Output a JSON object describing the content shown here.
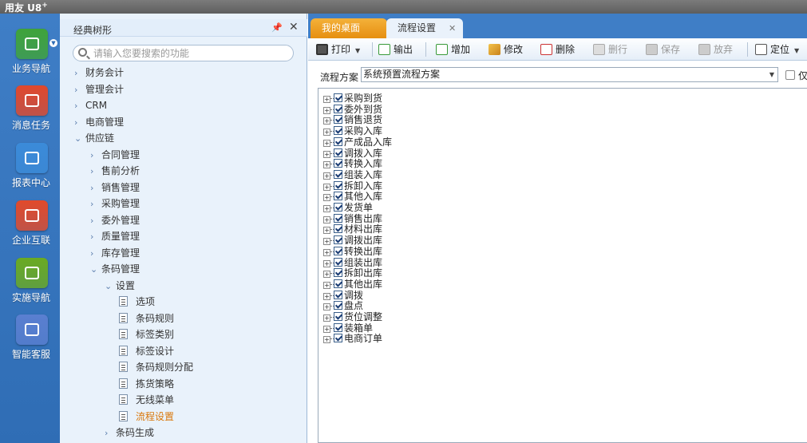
{
  "app": {
    "brand": "用友 U8",
    "brand_sup": "+"
  },
  "dock": [
    {
      "label": "业务导航",
      "icon": "business-nav-icon",
      "color": "#3fa33a"
    },
    {
      "label": "消息任务",
      "icon": "message-task-icon",
      "color": "#e0482c"
    },
    {
      "label": "报表中心",
      "icon": "report-center-icon",
      "color": "#3b8bd9"
    },
    {
      "label": "企业互联",
      "icon": "enterprise-link-icon",
      "color": "#e14a2b"
    },
    {
      "label": "实施导航",
      "icon": "implementation-nav-icon",
      "color": "#6aaa22"
    },
    {
      "label": "智能客服",
      "icon": "smart-service-icon",
      "color": "#5a7fd0"
    }
  ],
  "nav": {
    "title": "经典树形",
    "search_placeholder": "请输入您要搜索的功能",
    "tree": [
      {
        "label": "财务会计",
        "level": 0,
        "type": "collapsed"
      },
      {
        "label": "管理会计",
        "level": 0,
        "type": "collapsed"
      },
      {
        "label": "CRM",
        "level": 0,
        "type": "collapsed"
      },
      {
        "label": "电商管理",
        "level": 0,
        "type": "collapsed"
      },
      {
        "label": "供应链",
        "level": 0,
        "type": "expanded"
      },
      {
        "label": "合同管理",
        "level": 1,
        "type": "collapsed"
      },
      {
        "label": "售前分析",
        "level": 1,
        "type": "collapsed"
      },
      {
        "label": "销售管理",
        "level": 1,
        "type": "collapsed"
      },
      {
        "label": "采购管理",
        "level": 1,
        "type": "collapsed"
      },
      {
        "label": "委外管理",
        "level": 1,
        "type": "collapsed"
      },
      {
        "label": "质量管理",
        "level": 1,
        "type": "collapsed"
      },
      {
        "label": "库存管理",
        "level": 1,
        "type": "collapsed"
      },
      {
        "label": "条码管理",
        "level": 1,
        "type": "expanded"
      },
      {
        "label": "设置",
        "level": 2,
        "type": "expanded"
      },
      {
        "label": "选项",
        "level": 3,
        "type": "leaf"
      },
      {
        "label": "条码规则",
        "level": 3,
        "type": "leaf"
      },
      {
        "label": "标签类别",
        "level": 3,
        "type": "leaf"
      },
      {
        "label": "标签设计",
        "level": 3,
        "type": "leaf"
      },
      {
        "label": "条码规则分配",
        "level": 3,
        "type": "leaf"
      },
      {
        "label": "拣货策略",
        "level": 3,
        "type": "leaf"
      },
      {
        "label": "无线菜单",
        "level": 3,
        "type": "leaf"
      },
      {
        "label": "流程设置",
        "level": 3,
        "type": "leaf",
        "active": true
      },
      {
        "label": "条码生成",
        "level": 2,
        "type": "collapsed"
      }
    ]
  },
  "tabs": [
    {
      "label": "我的桌面"
    },
    {
      "label": "流程设置"
    }
  ],
  "toolbar": {
    "print": "打印",
    "export": "输出",
    "add": "增加",
    "edit": "修改",
    "delete": "删除",
    "delete_row": "删行",
    "save": "保存",
    "abandon": "放弃",
    "locate": "定位"
  },
  "scheme": {
    "label": "流程方案",
    "value": "系统预置流程方案",
    "only_label": "仅"
  },
  "flows": [
    {
      "label": "采购到货",
      "checked": true
    },
    {
      "label": "委外到货",
      "checked": true
    },
    {
      "label": "销售退货",
      "checked": true
    },
    {
      "label": "采购入库",
      "checked": true
    },
    {
      "label": "产成品入库",
      "checked": true
    },
    {
      "label": "调拨入库",
      "checked": true
    },
    {
      "label": "转换入库",
      "checked": true
    },
    {
      "label": "组装入库",
      "checked": true
    },
    {
      "label": "拆卸入库",
      "checked": true
    },
    {
      "label": "其他入库",
      "checked": true
    },
    {
      "label": "发货单",
      "checked": true
    },
    {
      "label": "销售出库",
      "checked": true
    },
    {
      "label": "材料出库",
      "checked": true
    },
    {
      "label": "调拨出库",
      "checked": true
    },
    {
      "label": "转换出库",
      "checked": true
    },
    {
      "label": "组装出库",
      "checked": true
    },
    {
      "label": "拆卸出库",
      "checked": true
    },
    {
      "label": "其他出库",
      "checked": true
    },
    {
      "label": "调拨",
      "checked": true
    },
    {
      "label": "盘点",
      "checked": true
    },
    {
      "label": "货位调整",
      "checked": true
    },
    {
      "label": "装箱单",
      "checked": true
    },
    {
      "label": "电商订单",
      "checked": true
    }
  ]
}
